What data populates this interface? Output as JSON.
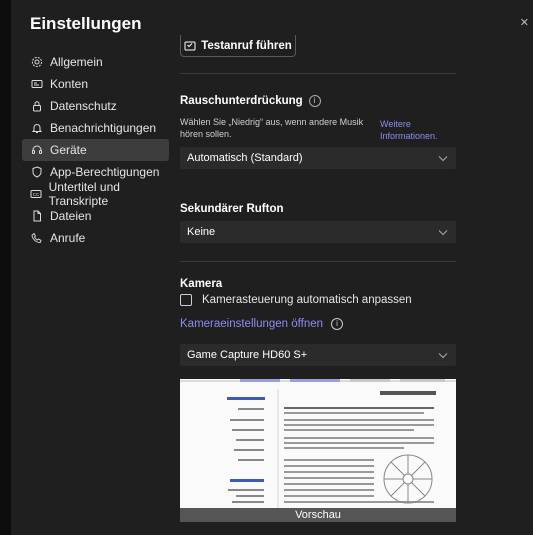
{
  "window": {
    "title": "Einstellungen"
  },
  "sidebar": {
    "items": [
      {
        "label": "Allgemein",
        "icon": "gear-icon"
      },
      {
        "label": "Konten",
        "icon": "id-card-icon"
      },
      {
        "label": "Datenschutz",
        "icon": "lock-icon"
      },
      {
        "label": "Benachrichtigungen",
        "icon": "bell-icon"
      },
      {
        "label": "Geräte",
        "icon": "headset-icon",
        "active": true
      },
      {
        "label": "App-Berechtigungen",
        "icon": "shield-icon"
      },
      {
        "label": "Untertitel und Transkripte",
        "icon": "cc-icon"
      },
      {
        "label": "Dateien",
        "icon": "file-icon"
      },
      {
        "label": "Anrufe",
        "icon": "phone-icon"
      }
    ]
  },
  "test_call": {
    "label": "Testanruf führen"
  },
  "noise": {
    "title": "Rauschunterdrückung",
    "description": "Wählen Sie „Niedrig“ aus, wenn andere Musik hören sollen.",
    "more_link": "Weitere Informationen.",
    "selected": "Automatisch (Standard)"
  },
  "secondary_ringer": {
    "title": "Sekundärer Rufton",
    "selected": "Keine"
  },
  "camera": {
    "title": "Kamera",
    "auto_adjust_label": "Kamerasteuerung automatisch anpassen",
    "auto_adjust_checked": false,
    "settings_link": "Kameraeinstellungen öffnen",
    "selected_device": "Game Capture HD60 S+",
    "preview_label": "Vorschau"
  },
  "colors": {
    "accent": "#8a8ff0",
    "active_bg": "#3d3d3d",
    "panel_bg": "#1f1f1f",
    "select_bg": "#2b2b2b"
  }
}
